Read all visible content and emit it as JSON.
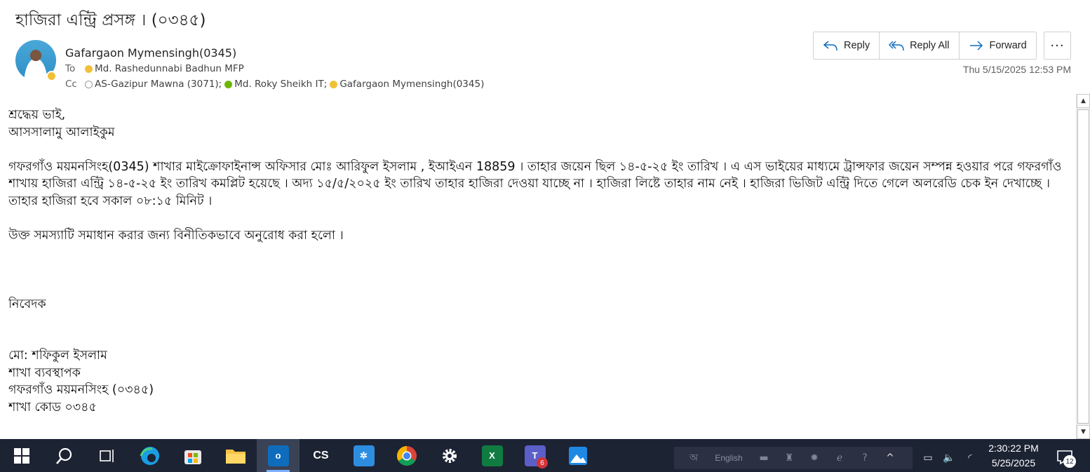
{
  "email": {
    "subject": "হাজিরা  এন্ট্রি প্রসঙ্গ । (০৩৪৫)",
    "sender": "Gafargaon Mymensingh(0345)",
    "to_label": "To",
    "cc_label": "Cc",
    "to": [
      {
        "name": "Md. Rashedunnabi Badhun MFP",
        "presence": "away"
      }
    ],
    "cc": [
      {
        "name": "AS-Gazipur Mawna (3071);",
        "presence": "offline"
      },
      {
        "name": "Md. Roky Sheikh IT;",
        "presence": "online"
      },
      {
        "name": "Gafargaon Mymensingh(0345)",
        "presence": "away"
      }
    ],
    "timestamp": "Thu 5/15/2025 12:53 PM",
    "actions": {
      "reply": "Reply",
      "reply_all": "Reply All",
      "forward": "Forward",
      "more": "···"
    },
    "body": {
      "greeting": "শ্রদ্ধেয় ভাই,",
      "salam": "আসসালামু আলাইকুম",
      "paragraph": "গফরগাঁও ময়মনসিংহ(0345)  শাখার মাইক্রোফাইনান্স অফিসার মোঃ আরিফুল ইসলাম , ইআইএন  18859 ।  তাহার জয়েন ছিল ১৪-৫-২৫ ইং তারিখ  । এ এস ভাইয়ের মাধ্যমে ট্রান্সফার জয়েন  সম্পন্ন  হওয়ার পরে গফরগাঁও শাখায় হাজিরা  এন্ট্রি ১৪-৫-২৫ ইং তারিখ  কমপ্লিট হয়েছে । অদ্য ১৫/৫/২০২৫ ইং তারিখ তাহার হাজিরা দেওয়া যাচ্ছে না ।  হাজিরা লিষ্টে তাহার নাম নেই । হাজিরা ভিজিট এন্ট্রি দিতে গেলে অলরেডি চেক ইন দেখাচ্ছে । তাহার হাজিরা হবে  সকাল  ০৮:১৫ মিনিট ।",
      "request": "উক্ত সমস্যাটি সমাধান করার জন্য বিনীতিকভাবে অনুরোধ করা হলো ।",
      "closing": "নিবেদক",
      "sig_name": "মো: শফিকুল ইসলাম",
      "sig_title": "শাখা ব্যবস্থাপক",
      "sig_branch": "গফরগাঁও ময়মনসিংহ (০৩৪৫)",
      "sig_code": "শাখা কোড ০৩৪৫"
    }
  },
  "taskbar": {
    "apps": [
      {
        "name": "start-icon"
      },
      {
        "name": "search-icon"
      },
      {
        "name": "task-view-icon"
      },
      {
        "name": "edge-icon"
      },
      {
        "name": "store-icon"
      },
      {
        "name": "file-explorer-icon"
      },
      {
        "name": "outlook-icon",
        "active": true
      },
      {
        "name": "cs-app-icon",
        "label": "CS"
      },
      {
        "name": "settings-app-icon"
      },
      {
        "name": "chrome-icon"
      },
      {
        "name": "gear-icon"
      },
      {
        "name": "excel-icon",
        "label": "X"
      },
      {
        "name": "teams-icon",
        "badge": "6"
      },
      {
        "name": "photos-icon"
      }
    ],
    "tray_language": "English",
    "clock_time": "2:30:22 PM",
    "clock_date": "5/25/2025",
    "notification_count": "12"
  },
  "colors": {
    "accent": "#0f6cbd",
    "taskbar": "#1c2333",
    "presence_away": "#f2c037",
    "presence_online": "#6bb700"
  }
}
